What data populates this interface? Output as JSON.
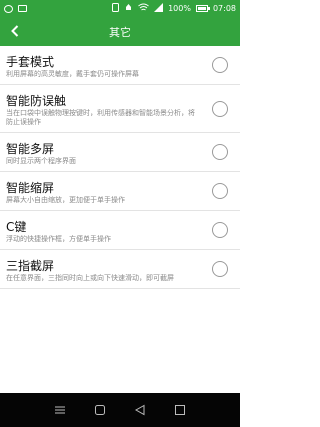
{
  "status_bar": {
    "battery": "100%",
    "time": "07:08",
    "icons": [
      "carrier-icon",
      "sim-icon",
      "phone-icon",
      "notification-icon",
      "wifi-icon",
      "signal-icon",
      "battery-icon"
    ]
  },
  "toolbar": {
    "title": "其它",
    "back_icon": "back-arrow-icon",
    "background": "#33a33e"
  },
  "items": [
    {
      "title": "手套模式",
      "desc": "利用屏幕的高灵敏度，戴手套仍可操作屏幕",
      "checked": false
    },
    {
      "title": "智能防误触",
      "desc": "当在口袋中误触物理按键时，利用传感器和智能场景分析，将防止误操作",
      "checked": false
    },
    {
      "title": "智能多屏",
      "desc": "同时显示两个程序界面",
      "checked": false
    },
    {
      "title": "智能缩屏",
      "desc": "屏幕大小自由缩放，更加便于单手操作",
      "checked": false
    },
    {
      "title": "C键",
      "desc": "浮动的快捷操作框，方便单手操作",
      "checked": false
    },
    {
      "title": "三指截屏",
      "desc": "在任意界面，三指同时向上或向下快速滑动，即可截屏",
      "checked": false
    }
  ],
  "nav_bar": {
    "icons": [
      "menu-icon",
      "home-icon",
      "back-icon",
      "recents-icon"
    ]
  }
}
